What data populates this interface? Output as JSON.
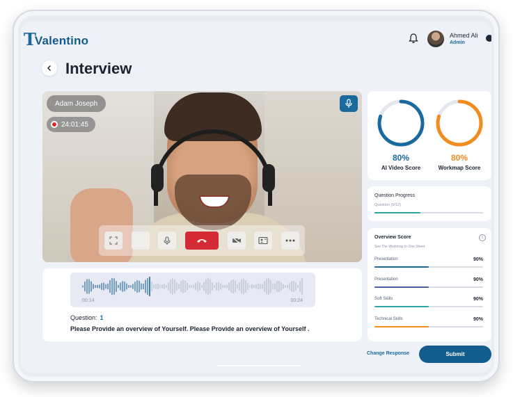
{
  "app": {
    "brand": "Valentino",
    "brand_mark": "T"
  },
  "user": {
    "name": "Ahmed Ali",
    "role": "Admin"
  },
  "page": {
    "title": "Interview"
  },
  "video": {
    "participant": "Adam Joseph",
    "timer": "24:01:45",
    "controls": [
      "fullscreen-icon",
      "blank",
      "mic-icon",
      "end-call-icon",
      "video-off-icon",
      "screen-share-icon",
      "more-icon"
    ]
  },
  "audio": {
    "start": "00:14",
    "end": "00:24"
  },
  "question": {
    "label": "Question:",
    "number": "1",
    "text": "Please Provide an overview of Yourself. Please Provide an overview of Yourself ."
  },
  "scores": [
    {
      "value": "80%",
      "label": "AI Video Score",
      "fraction": 0.8,
      "color": "#1a6aa0"
    },
    {
      "value": "80%",
      "label": "Workmap Score",
      "fraction": 0.8,
      "color": "#f28c1e"
    }
  ],
  "progress": {
    "title": "Question Progress",
    "subtitle": "Question (5/12)",
    "fraction": 0.42
  },
  "overview": {
    "title": "Overview Score",
    "subtitle": "See The Workmap In One Sheet",
    "skills": [
      {
        "name": "Presentation",
        "value": "90%",
        "fraction": 0.5,
        "color": "#1a6aa0"
      },
      {
        "name": "Presentation",
        "value": "90%",
        "fraction": 0.5,
        "color": "#4a5f9a"
      },
      {
        "name": "Soft Skills",
        "value": "90%",
        "fraction": 0.5,
        "color": "#2aa6a6"
      },
      {
        "name": "Technical Skills",
        "value": "90%",
        "fraction": 0.5,
        "color": "#f28c1e"
      }
    ]
  },
  "actions": {
    "change": "Change Response",
    "submit": "Submit"
  }
}
